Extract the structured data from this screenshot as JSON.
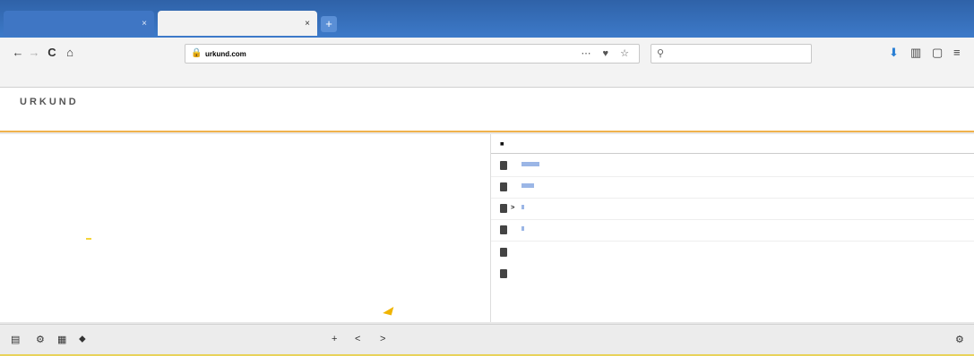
{
  "tabs": [
    {
      "label": "",
      "close": "×"
    },
    {
      "label": "",
      "close": "×"
    }
  ],
  "new_tab": "+",
  "window_controls": "",
  "nav": {
    "back": "←",
    "forward": "→",
    "reload": "C",
    "home": "⌂",
    "url_prefix": "",
    "url_domain": "urkund.com",
    "url_rest": "",
    "search_placeholder": "",
    "url_icons": "⋯ ♥ ☆"
  },
  "bookmarks": [
    "",
    "",
    ""
  ],
  "urkund": {
    "logo": "URKUND",
    "tabs": [
      "",
      ""
    ],
    "user": ""
  },
  "document": {
    "labels": [
      "",
      "",
      "",
      "",
      ""
    ],
    "values": [
      "",
      "",
      "",
      "",
      ""
    ],
    "warning_badge": "",
    "warning_text": ""
  },
  "sources": {
    "headers": [
      "",
      ""
    ],
    "rows": [
      {
        "link": "",
        "tail": ""
      },
      {
        "link": "",
        "tail": ""
      },
      {
        "link": "",
        "tail": ""
      },
      {
        "link": "",
        "tail": ""
      }
    ],
    "sections": [
      "",
      ""
    ]
  },
  "bottom": {
    "actions": [
      "",
      "",
      "",
      ""
    ],
    "nav_up": "+",
    "nav_prev": "<",
    "nav_next": ">"
  }
}
